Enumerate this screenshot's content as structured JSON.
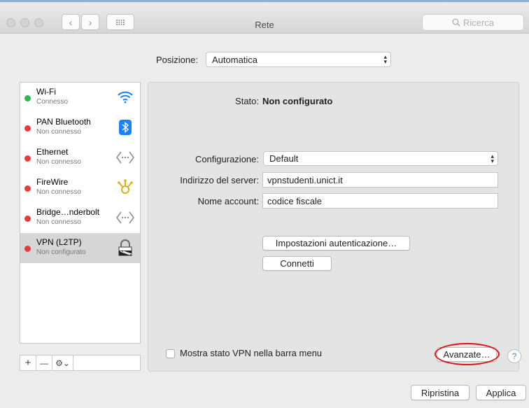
{
  "window": {
    "title": "Rete",
    "search_placeholder": "Ricerca",
    "search_icon": "magnifier-icon",
    "back_icon": "chevron-left-icon",
    "forward_icon": "chevron-right-icon",
    "grid_icon": "grid-icon"
  },
  "location": {
    "label": "Posizione:",
    "value": "Automatica"
  },
  "sidebar": {
    "items": [
      {
        "name": "Wi-Fi",
        "status": "Connesso",
        "status_color": "#2fb84a",
        "icon": "wifi-icon"
      },
      {
        "name": "PAN Bluetooth",
        "status": "Non connesso",
        "status_color": "#e83a3a",
        "icon": "bluetooth-icon"
      },
      {
        "name": "Ethernet",
        "status": "Non connesso",
        "status_color": "#e83a3a",
        "icon": "ethernet-icon"
      },
      {
        "name": "FireWire",
        "status": "Non connesso",
        "status_color": "#e83a3a",
        "icon": "firewire-icon"
      },
      {
        "name": "Bridge…nderbolt",
        "status": "Non connesso",
        "status_color": "#e83a3a",
        "icon": "bridge-icon"
      },
      {
        "name": "VPN (L2TP)",
        "status": "Non configurato",
        "status_color": "#e83a3a",
        "icon": "vpn-lock-icon"
      }
    ],
    "add_label": "+",
    "remove_label": "—",
    "gear_label": "⚙︎⌄"
  },
  "detail": {
    "status_label": "Stato:",
    "status_value": "Non configurato",
    "config_label": "Configurazione:",
    "config_value": "Default",
    "server_label": "Indirizzo del server:",
    "server_value": "vpnstudenti.unict.it",
    "account_label": "Nome account:",
    "account_value": "codice fiscale",
    "auth_button": "Impostazioni autenticazione…",
    "connect_button": "Connetti",
    "show_vpn_label": "Mostra stato VPN nella barra menu",
    "advanced_button": "Avanzate…",
    "help_label": "?"
  },
  "footer": {
    "revert_button": "Ripristina",
    "apply_button": "Applica"
  },
  "colors": {
    "accent": "#1a82fb",
    "highlight_ellipse": "#d9141c"
  }
}
